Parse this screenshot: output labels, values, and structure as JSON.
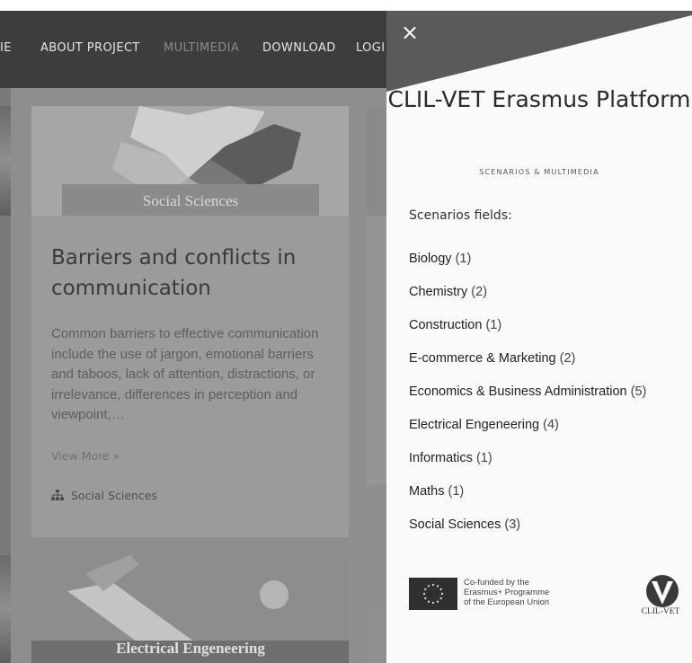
{
  "nav": {
    "items": [
      {
        "label": "IE",
        "dim": false
      },
      {
        "label": "ABOUT PROJECT",
        "dim": false
      },
      {
        "label": "MULTIMEDIA",
        "dim": true
      },
      {
        "label": "DOWNLOAD",
        "dim": false
      },
      {
        "label": "LOGI",
        "dim": false
      }
    ]
  },
  "card": {
    "image_caption": "Social Sciences",
    "title": "Barriers and conflicts in communication",
    "excerpt": "Common barriers to effective communication include the use of jargon, emotional barriers and taboos, lack of attention, distractions, or irrelevance, differences in perception and viewpoint,…",
    "view_more": "View More »",
    "category": "Social Sciences"
  },
  "card2": {
    "image_caption": "Electrical Engeneering"
  },
  "panel": {
    "close_label": "×",
    "title": "CLIL-VET Erasmus Platform",
    "subtitle": "SCENARIOS & MULTIMEDIA",
    "fields_heading": "Scenarios fields:",
    "fields": [
      {
        "name": "Biology",
        "count": "(1)"
      },
      {
        "name": "Chemistry",
        "count": "(2)"
      },
      {
        "name": "Construction",
        "count": "(1)"
      },
      {
        "name": "E-commerce & Marketing",
        "count": "(2)"
      },
      {
        "name": "Economics & Business Administration",
        "count": "(5)"
      },
      {
        "name": "Electrical Engeneering",
        "count": "(4)"
      },
      {
        "name": "Informatics",
        "count": "(1)"
      },
      {
        "name": "Maths",
        "count": "(1)"
      },
      {
        "name": "Social Sciences",
        "count": "(3)"
      }
    ],
    "eu_text_lines": [
      "Co-funded by the",
      "Erasmus+ Programme",
      "of the European Union"
    ],
    "clil_logo_text": "CLIL-VET"
  },
  "colors": {
    "topbar": "#3d3d3d",
    "panel_bg": "#fafafa",
    "overlay_bg": "#8e8e8e"
  }
}
